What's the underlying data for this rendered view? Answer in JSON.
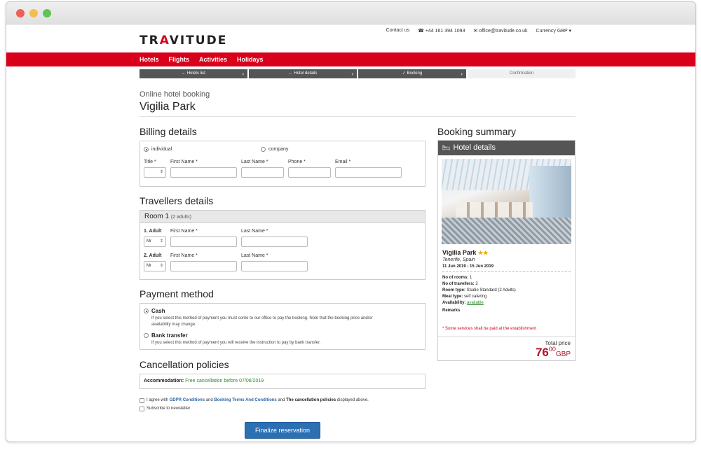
{
  "brand": {
    "logo_part1": "TR",
    "logo_accent": "A",
    "logo_part2": "VITUDE"
  },
  "toplinks": {
    "contact": "Contact us",
    "phone": "+44 161 394 1093",
    "email": "office@travitude.co.uk",
    "currency": "Currency GBP"
  },
  "nav": {
    "hotels": "Hotels",
    "flights": "Flights",
    "activities": "Activities",
    "holidays": "Holidays"
  },
  "steps": [
    {
      "label": "Hotels list"
    },
    {
      "label": "Hotel details"
    },
    {
      "label": "Booking"
    },
    {
      "label": "Confirmation"
    }
  ],
  "header": {
    "subtitle": "Online hotel booking",
    "hotel": "Vigilia Park"
  },
  "billing": {
    "title": "Billing details",
    "type_individual": "individual",
    "type_company": "company",
    "title_label": "Title *",
    "first_name_label": "First Name *",
    "last_name_label": "Last Name *",
    "phone_label": "Phone *",
    "email_label": "Email *"
  },
  "travellers": {
    "title": "Travellers details",
    "room_label": "Room 1",
    "room_note": "(2 adults)",
    "adult1_label": "1. Adult",
    "adult2_label": "2. Adult",
    "first_name_label": "First Name *",
    "last_name_label": "Last Name *",
    "title_value": "Mr"
  },
  "payment": {
    "title": "Payment method",
    "cash_title": "Cash",
    "cash_desc_1": "If you select this method of payment you must come to our office to pay the booking. Note that the booking price and/or",
    "cash_desc_2": "availability may change.",
    "bank_title": "Bank transfer",
    "bank_desc": "If you select this method of payment you will receive the instruction to pay by bank transfer."
  },
  "cancellation": {
    "title": "Cancellation policies",
    "label": "Accommodation:",
    "value": "Free cancellation before 07/06/2019"
  },
  "agree": {
    "prefix": "I agree with",
    "gdpr": "GDPR Conditions",
    "and1": "and",
    "terms": "Booking Terms And Conditions",
    "and2": "and",
    "policies": "The cancellation policies",
    "suffix": "displayed above.",
    "newsletter": "Subscribe to newsletter"
  },
  "finalize_label": "Finalize reservation",
  "summary": {
    "title": "Booking summary",
    "head": "Hotel details",
    "hotel_name": "Vigilia Park",
    "stars": "★★",
    "location": "Tenerife, Spain",
    "dates": "11 Jun 2019 - 15 Jun 2019",
    "rooms_label": "No of rooms:",
    "rooms_value": "1",
    "travellers_label": "No of travellers:",
    "travellers_value": "2",
    "room_type_label": "Room type:",
    "room_type_value": "Studio Standard (2 Adults)",
    "meal_label": "Meal type:",
    "meal_value": "self catering",
    "availability_label": "Availability:",
    "availability_value": "available",
    "remarks_label": "Remarks",
    "note": "* Some services shall be paid at the establishment",
    "total_label": "Total price",
    "total_int": "76",
    "total_dec": "00",
    "currency": "GBP"
  },
  "colors": {
    "brand_red": "#d9001b",
    "button_blue": "#2c6fb3",
    "price_red": "#b0142b",
    "ok_green": "#2e8b2e"
  }
}
